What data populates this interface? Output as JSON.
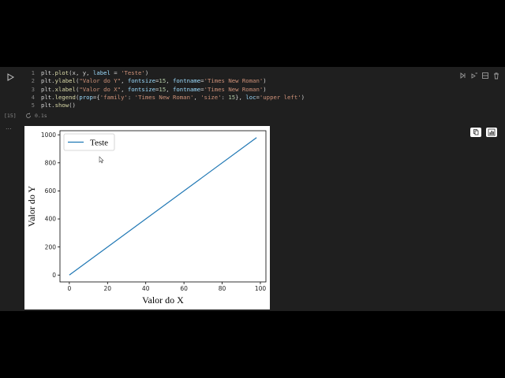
{
  "notebook": {
    "cell": {
      "run_icon": "play-icon",
      "lines": [
        {
          "num": "1",
          "tokens": [
            {
              "t": "plt.",
              "c": "p"
            },
            {
              "t": "plot",
              "c": "fn"
            },
            {
              "t": "(x, y, ",
              "c": "p"
            },
            {
              "t": "label",
              "c": "kw"
            },
            {
              "t": " = ",
              "c": "p"
            },
            {
              "t": "'Teste'",
              "c": "str"
            },
            {
              "t": ")",
              "c": "p"
            }
          ]
        },
        {
          "num": "2",
          "tokens": [
            {
              "t": "plt.",
              "c": "p"
            },
            {
              "t": "ylabel",
              "c": "fn"
            },
            {
              "t": "(",
              "c": "p"
            },
            {
              "t": "\"Valor do Y\"",
              "c": "str"
            },
            {
              "t": ", ",
              "c": "p"
            },
            {
              "t": "fontsize",
              "c": "kw"
            },
            {
              "t": "=",
              "c": "p"
            },
            {
              "t": "15",
              "c": "num"
            },
            {
              "t": ", ",
              "c": "p"
            },
            {
              "t": "fontname",
              "c": "kw"
            },
            {
              "t": "=",
              "c": "p"
            },
            {
              "t": "'Times New Roman'",
              "c": "str"
            },
            {
              "t": ")",
              "c": "p"
            }
          ]
        },
        {
          "num": "3",
          "tokens": [
            {
              "t": "plt.",
              "c": "p"
            },
            {
              "t": "xlabel",
              "c": "fn"
            },
            {
              "t": "(",
              "c": "p"
            },
            {
              "t": "\"Valor do X\"",
              "c": "str"
            },
            {
              "t": ", ",
              "c": "p"
            },
            {
              "t": "fontsize",
              "c": "kw"
            },
            {
              "t": "=",
              "c": "p"
            },
            {
              "t": "15",
              "c": "num"
            },
            {
              "t": ", ",
              "c": "p"
            },
            {
              "t": "fontname",
              "c": "kw"
            },
            {
              "t": "=",
              "c": "p"
            },
            {
              "t": "'Times New Roman'",
              "c": "str"
            },
            {
              "t": ")",
              "c": "p"
            }
          ]
        },
        {
          "num": "4",
          "tokens": [
            {
              "t": "plt.",
              "c": "p"
            },
            {
              "t": "legend",
              "c": "fn"
            },
            {
              "t": "(",
              "c": "p"
            },
            {
              "t": "prop",
              "c": "kw"
            },
            {
              "t": "={",
              "c": "p"
            },
            {
              "t": "'family'",
              "c": "str"
            },
            {
              "t": ": ",
              "c": "p"
            },
            {
              "t": "'Times New Roman'",
              "c": "str"
            },
            {
              "t": ", ",
              "c": "p"
            },
            {
              "t": "'size'",
              "c": "str"
            },
            {
              "t": ": ",
              "c": "p"
            },
            {
              "t": "15",
              "c": "num"
            },
            {
              "t": "}, ",
              "c": "p"
            },
            {
              "t": "loc",
              "c": "kw"
            },
            {
              "t": "=",
              "c": "p"
            },
            {
              "t": "'upper left'",
              "c": "str"
            },
            {
              "t": ")",
              "c": "p"
            }
          ]
        },
        {
          "num": "5",
          "tokens": [
            {
              "t": "plt.",
              "c": "p"
            },
            {
              "t": "show",
              "c": "fn"
            },
            {
              "t": "()",
              "c": "p"
            }
          ]
        }
      ],
      "toolbar_icons": [
        "run-by-line-icon",
        "execute-above-icon",
        "split-cell-icon",
        "delete-icon"
      ],
      "exec_count": "[15]",
      "exec_time": "0.1s"
    },
    "output": {
      "dots": "...",
      "actions": [
        "copy-icon",
        "chart-icon"
      ]
    }
  },
  "chart_data": {
    "type": "line",
    "series": [
      {
        "name": "Teste",
        "x": [
          0,
          98
        ],
        "y": [
          0,
          980
        ],
        "color": "#1f77b4"
      }
    ],
    "xlabel": "Valor do X",
    "ylabel": "Valor do Y",
    "xticks": [
      0,
      20,
      40,
      60,
      80,
      100
    ],
    "yticks": [
      0,
      200,
      400,
      600,
      800,
      1000
    ],
    "xlim": [
      -4.9,
      102.9
    ],
    "ylim": [
      -49,
      1029
    ],
    "legend": {
      "position": "upper left",
      "entries": [
        "Teste"
      ]
    },
    "grid": false
  }
}
